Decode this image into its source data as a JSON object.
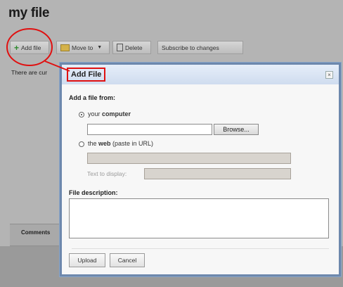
{
  "page": {
    "title": "my file",
    "background_text": "There are cur",
    "comments_label": "Comments"
  },
  "toolbar": {
    "add_file_label": "Add file",
    "move_to_label": "Move to",
    "delete_label": "Delete",
    "subscribe_label": "Subscribe to changes"
  },
  "dialog": {
    "title": "Add File",
    "close_glyph": "×",
    "add_from_label": "Add a file from:",
    "computer_option": {
      "prefix": "your ",
      "bold": "computer",
      "selected": true
    },
    "browse_label": "Browse...",
    "web_option": {
      "prefix": "the ",
      "bold": "web",
      "suffix": " (paste in URL)",
      "selected": false
    },
    "text_to_display_label": "Text to display:",
    "file_description_label": "File description:",
    "upload_label": "Upload",
    "cancel_label": "Cancel"
  },
  "colors": {
    "highlight": "#e01010",
    "dialog_border": "#6d88ad",
    "header_bg": "#d6e2f2"
  },
  "icons": [
    "plus-icon",
    "folder-icon",
    "trash-icon",
    "caret-down-icon",
    "close-icon"
  ]
}
